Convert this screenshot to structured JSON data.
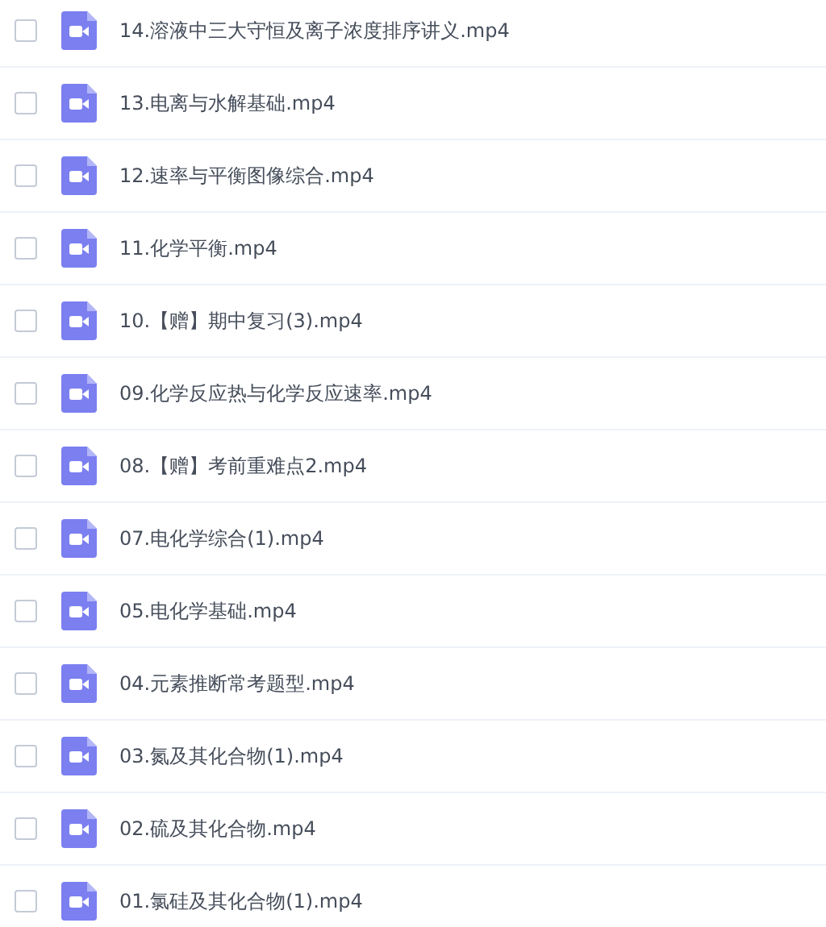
{
  "files": [
    {
      "name": "14.溶液中三大守恒及离子浓度排序讲义.mp4",
      "checked": false
    },
    {
      "name": "13.电离与水解基础.mp4",
      "checked": false
    },
    {
      "name": "12.速率与平衡图像综合.mp4",
      "checked": false
    },
    {
      "name": "11.化学平衡.mp4",
      "checked": false
    },
    {
      "name": "10.【赠】期中复习(3).mp4",
      "checked": false
    },
    {
      "name": "09.化学反应热与化学反应速率.mp4",
      "checked": false
    },
    {
      "name": "08.【赠】考前重难点2.mp4",
      "checked": false
    },
    {
      "name": "07.电化学综合(1).mp4",
      "checked": false
    },
    {
      "name": "05.电化学基础.mp4",
      "checked": false
    },
    {
      "name": "04.元素推断常考题型.mp4",
      "checked": false
    },
    {
      "name": "03.氮及其化合物(1).mp4",
      "checked": false
    },
    {
      "name": "02.硫及其化合物.mp4",
      "checked": false
    },
    {
      "name": "01.氯硅及其化合物(1).mp4",
      "checked": false
    }
  ]
}
